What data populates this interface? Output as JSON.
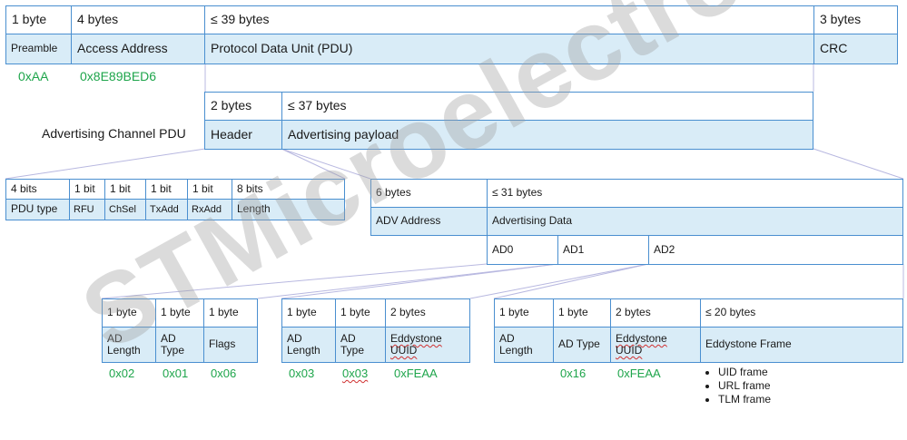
{
  "packet": {
    "sizes": [
      "1 byte",
      "4 bytes",
      "≤ 39 bytes",
      "3 bytes"
    ],
    "fields": [
      "Preamble",
      "Access Address",
      "Protocol Data Unit (PDU)",
      "CRC"
    ],
    "values": [
      "0xAA",
      "0x8E89BED6"
    ]
  },
  "adv_pdu": {
    "label": "Advertising Channel PDU",
    "sizes": [
      "2 bytes",
      "≤ 37 bytes"
    ],
    "fields": [
      "Header",
      "Advertising payload"
    ]
  },
  "header_bits": {
    "sizes": [
      "4 bits",
      "1 bit",
      "1 bit",
      "1 bit",
      "1 bit",
      "8 bits"
    ],
    "fields": [
      "PDU type",
      "RFU",
      "ChSel",
      "TxAdd",
      "RxAdd",
      "Length"
    ]
  },
  "payload": {
    "sizes": [
      "6 bytes",
      "≤ 31 bytes"
    ],
    "fields": [
      "ADV Address",
      "Advertising Data"
    ],
    "ad_items": [
      "AD0",
      "AD1",
      "AD2"
    ]
  },
  "ad0": {
    "sizes": [
      "1 byte",
      "1 byte",
      "1 byte"
    ],
    "fields": [
      "AD Length",
      "AD Type",
      "Flags"
    ],
    "values": [
      "0x02",
      "0x01",
      "0x06"
    ]
  },
  "ad1": {
    "sizes": [
      "1 byte",
      "1 byte",
      "2 bytes"
    ],
    "fields": [
      "AD Length",
      "AD Type",
      "Eddystone UUID"
    ],
    "values": [
      "0x03",
      "0x03",
      "0xFEAA"
    ]
  },
  "ad2": {
    "sizes": [
      "1 byte",
      "1 byte",
      "2 bytes",
      "≤ 20 bytes"
    ],
    "fields": [
      "AD Length",
      "AD Type",
      "Eddystone UUID",
      "Eddystone Frame"
    ],
    "values": [
      "0x16",
      "0xFEAA"
    ],
    "frames": [
      "UID frame",
      "URL frame",
      "TLM frame"
    ]
  },
  "watermark": "STMicroelectronics",
  "colors": {
    "border": "#4a8fd0",
    "fill": "#d9ecf7",
    "value": "#1ea54b",
    "connector": "#b8b8e0"
  }
}
